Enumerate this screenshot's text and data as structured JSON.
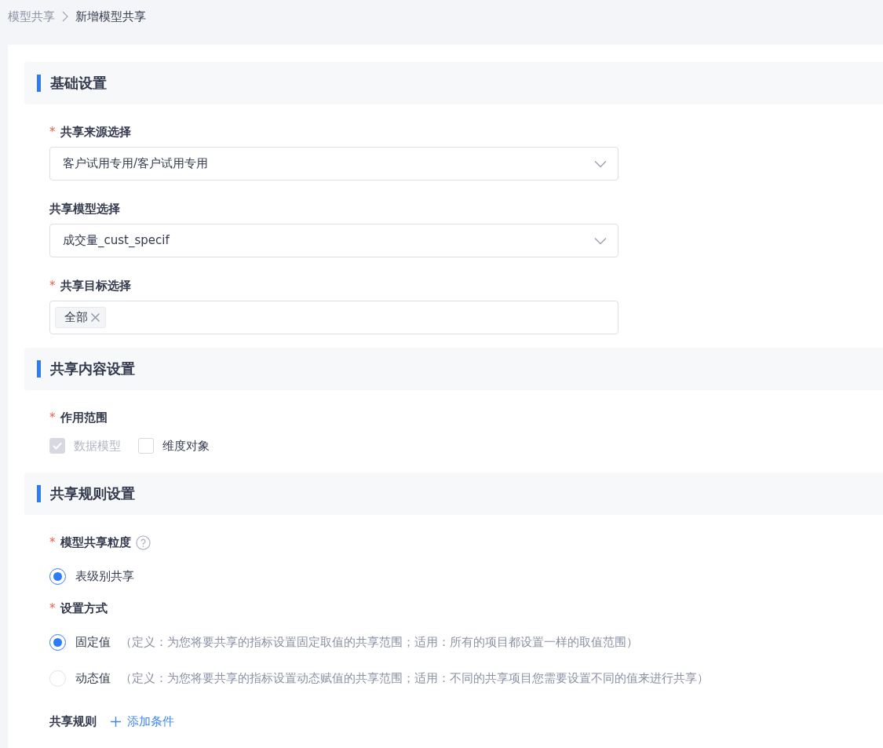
{
  "breadcrumb": [
    {
      "label": "模型共享",
      "current": false
    },
    {
      "label": "新增模型共享",
      "current": true
    }
  ],
  "sections": [
    {
      "title": "基础设置",
      "fields": [
        {
          "kind": "select",
          "label": "共享来源选择",
          "required_mark": "*",
          "value": "客户试用专用/客户试用专用"
        },
        {
          "kind": "select",
          "label": "共享模型选择",
          "value": "成交量_cust_specif"
        },
        {
          "kind": "tags",
          "label": "共享目标选择",
          "required_mark": "*",
          "tags": [
            "全部"
          ]
        }
      ]
    },
    {
      "title": "共享内容设置",
      "fields": [
        {
          "kind": "checkboxes",
          "label": "作用范围",
          "required_mark": "*",
          "options": [
            {
              "label": "数据模型",
              "checked": true,
              "disabled": true
            },
            {
              "label": "维度对象",
              "checked": false,
              "disabled": false
            }
          ]
        }
      ]
    },
    {
      "title": "共享规则设置",
      "fields": [
        {
          "kind": "radios",
          "label": "模型共享粒度",
          "required_mark": "*",
          "help": true,
          "options": [
            {
              "label": "表级别共享",
              "selected": true
            }
          ]
        },
        {
          "kind": "radios",
          "label": "设置方式",
          "required_mark": "*",
          "options": [
            {
              "label": "固定值",
              "note": "（定义：为您将要共享的指标设置固定取值的共享范围；适用：所有的项目都设置一样的取值范围）",
              "selected": true
            },
            {
              "label": "动态值",
              "note": "（定义：为您将要共享的指标设置动态赋值的共享范围；适用：不同的共享项目您需要设置不同的值来进行共享）",
              "selected": false
            }
          ]
        },
        {
          "kind": "action",
          "label": "共享规则",
          "action": "添加条件"
        }
      ]
    }
  ]
}
